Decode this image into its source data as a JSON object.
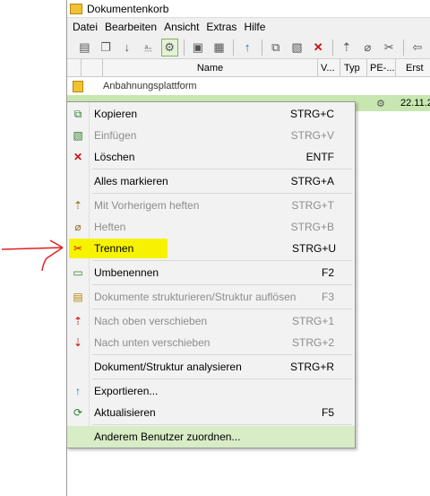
{
  "window": {
    "title": "Dokumentenkorb"
  },
  "menubar": [
    "Datei",
    "Bearbeiten",
    "Ansicht",
    "Extras",
    "Hilfe"
  ],
  "toolbar": {
    "buttons": [
      {
        "icon": "new-doc-icon"
      },
      {
        "icon": "copy-doc-icon"
      },
      {
        "icon": "download-icon"
      },
      {
        "icon": "scan-icon"
      },
      {
        "icon": "network-icon",
        "active": true
      },
      {
        "icon": "save-icon"
      },
      {
        "icon": "save-all-icon"
      },
      {
        "icon": "upload-icon"
      },
      {
        "icon": "copy-icon"
      },
      {
        "icon": "paste-icon"
      },
      {
        "icon": "delete-icon"
      },
      {
        "icon": "attach-prev-icon"
      },
      {
        "icon": "attach-icon"
      },
      {
        "icon": "detach-icon"
      },
      {
        "icon": "import-icon"
      }
    ]
  },
  "grid": {
    "columns": [
      "Name",
      "V...",
      "Typ",
      "PE-...",
      "Erst"
    ],
    "rows": [
      {
        "name": "Anbahnungsplattform"
      },
      {
        "date": "22.11.2"
      }
    ]
  },
  "context_menu": {
    "items": [
      {
        "icon": "copy-icon",
        "label": "Kopieren",
        "shortcut": "STRG+C",
        "disabled": false
      },
      {
        "icon": "paste-icon",
        "label": "Einfügen",
        "shortcut": "STRG+V",
        "disabled": true
      },
      {
        "icon": "delete-icon",
        "label": "Löschen",
        "shortcut": "ENTF",
        "disabled": false
      },
      {
        "icon": "",
        "label": "Alles markieren",
        "shortcut": "STRG+A",
        "disabled": false
      },
      {
        "icon": "attach-prev-icon",
        "label": "Mit Vorherigem heften",
        "shortcut": "STRG+T",
        "disabled": true
      },
      {
        "icon": "attach-icon",
        "label": "Heften",
        "shortcut": "STRG+B",
        "disabled": true
      },
      {
        "icon": "detach-icon",
        "label": "Trennen",
        "shortcut": "STRG+U",
        "disabled": false,
        "highlighted": true
      },
      {
        "icon": "rename-icon",
        "label": "Umbenennen",
        "shortcut": "F2",
        "disabled": false
      },
      {
        "icon": "structure-icon",
        "label": "Dokumente strukturieren/Struktur auflösen",
        "shortcut": "F3",
        "disabled": true
      },
      {
        "icon": "move-up-icon",
        "label": "Nach oben verschieben",
        "shortcut": "STRG+1",
        "disabled": true
      },
      {
        "icon": "move-down-icon",
        "label": "Nach unten verschieben",
        "shortcut": "STRG+2",
        "disabled": true
      },
      {
        "icon": "",
        "label": "Dokument/Struktur analysieren",
        "shortcut": "STRG+R",
        "disabled": false
      },
      {
        "icon": "export-icon",
        "label": "Exportieren...",
        "shortcut": "",
        "disabled": false
      },
      {
        "icon": "refresh-icon",
        "label": "Aktualisieren",
        "shortcut": "F5",
        "disabled": false
      },
      {
        "icon": "",
        "label": "Anderem Benutzer zuordnen...",
        "shortcut": "",
        "disabled": false,
        "hovered": true
      }
    ]
  },
  "annotation": {
    "highlight_color": "#f7f300",
    "arrow_color": "#e02020"
  }
}
